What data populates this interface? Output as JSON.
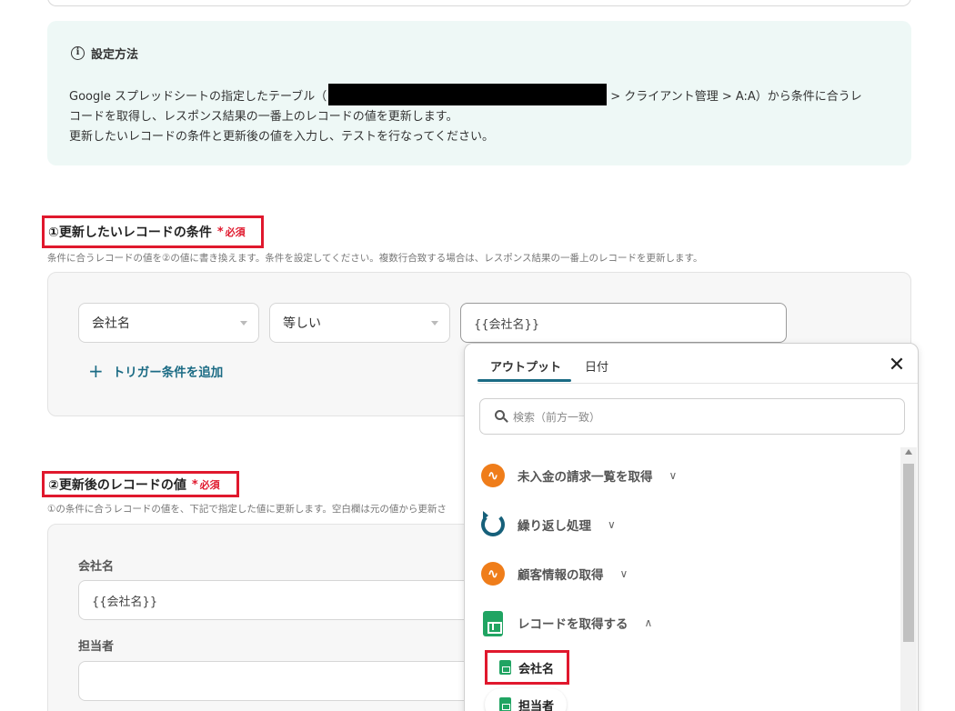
{
  "info": {
    "title": "設定方法",
    "line1_pre": "Google スプレッドシートの指定したテーブル（",
    "line1_post": "> クライアント管理 > A:A）から条件に合うレ",
    "line2": "コードを取得し、レスポンス結果の一番上のレコードの値を更新します。",
    "line3": "更新したいレコードの条件と更新後の値を入力し、テストを行なってください。"
  },
  "section1": {
    "label": "①更新したいレコードの条件",
    "required": "必須",
    "description": "条件に合うレコードの値を②の値に書き換えます。条件を設定してください。複数行合致する場合は、レスポンス結果の一番上のレコードを更新します。",
    "field_select": "会社名",
    "operator_select": "等しい",
    "value": "{{会社名}}",
    "add_trigger": "トリガー条件を追加"
  },
  "section2": {
    "label": "②更新後のレコードの値",
    "required": "必須",
    "description": "①の条件に合うレコードの値を、下記で指定した値に更新します。空白欄は元の値から更新さ",
    "fields": [
      {
        "label": "会社名",
        "value": "{{会社名}}"
      },
      {
        "label": "担当者",
        "value": ""
      }
    ]
  },
  "dropdown": {
    "tabs": [
      "アウトプット",
      "日付"
    ],
    "search_placeholder": "検索（前方一致）",
    "items": [
      {
        "label": "未入金の請求一覧を取得",
        "icon": "orange-app-icon"
      },
      {
        "label": "繰り返し処理",
        "icon": "loop-icon"
      },
      {
        "label": "顧客情報の取得",
        "icon": "orange-app-icon"
      },
      {
        "label": "レコードを取得する",
        "icon": "google-sheets-icon"
      }
    ],
    "sub_items": [
      "会社名",
      "担当者"
    ]
  },
  "colors": {
    "accent": "#1b6b84",
    "required": "#e0182d",
    "sheets_green": "#20a462",
    "orange": "#ef7d1a",
    "info_bg": "#eef8f6"
  }
}
